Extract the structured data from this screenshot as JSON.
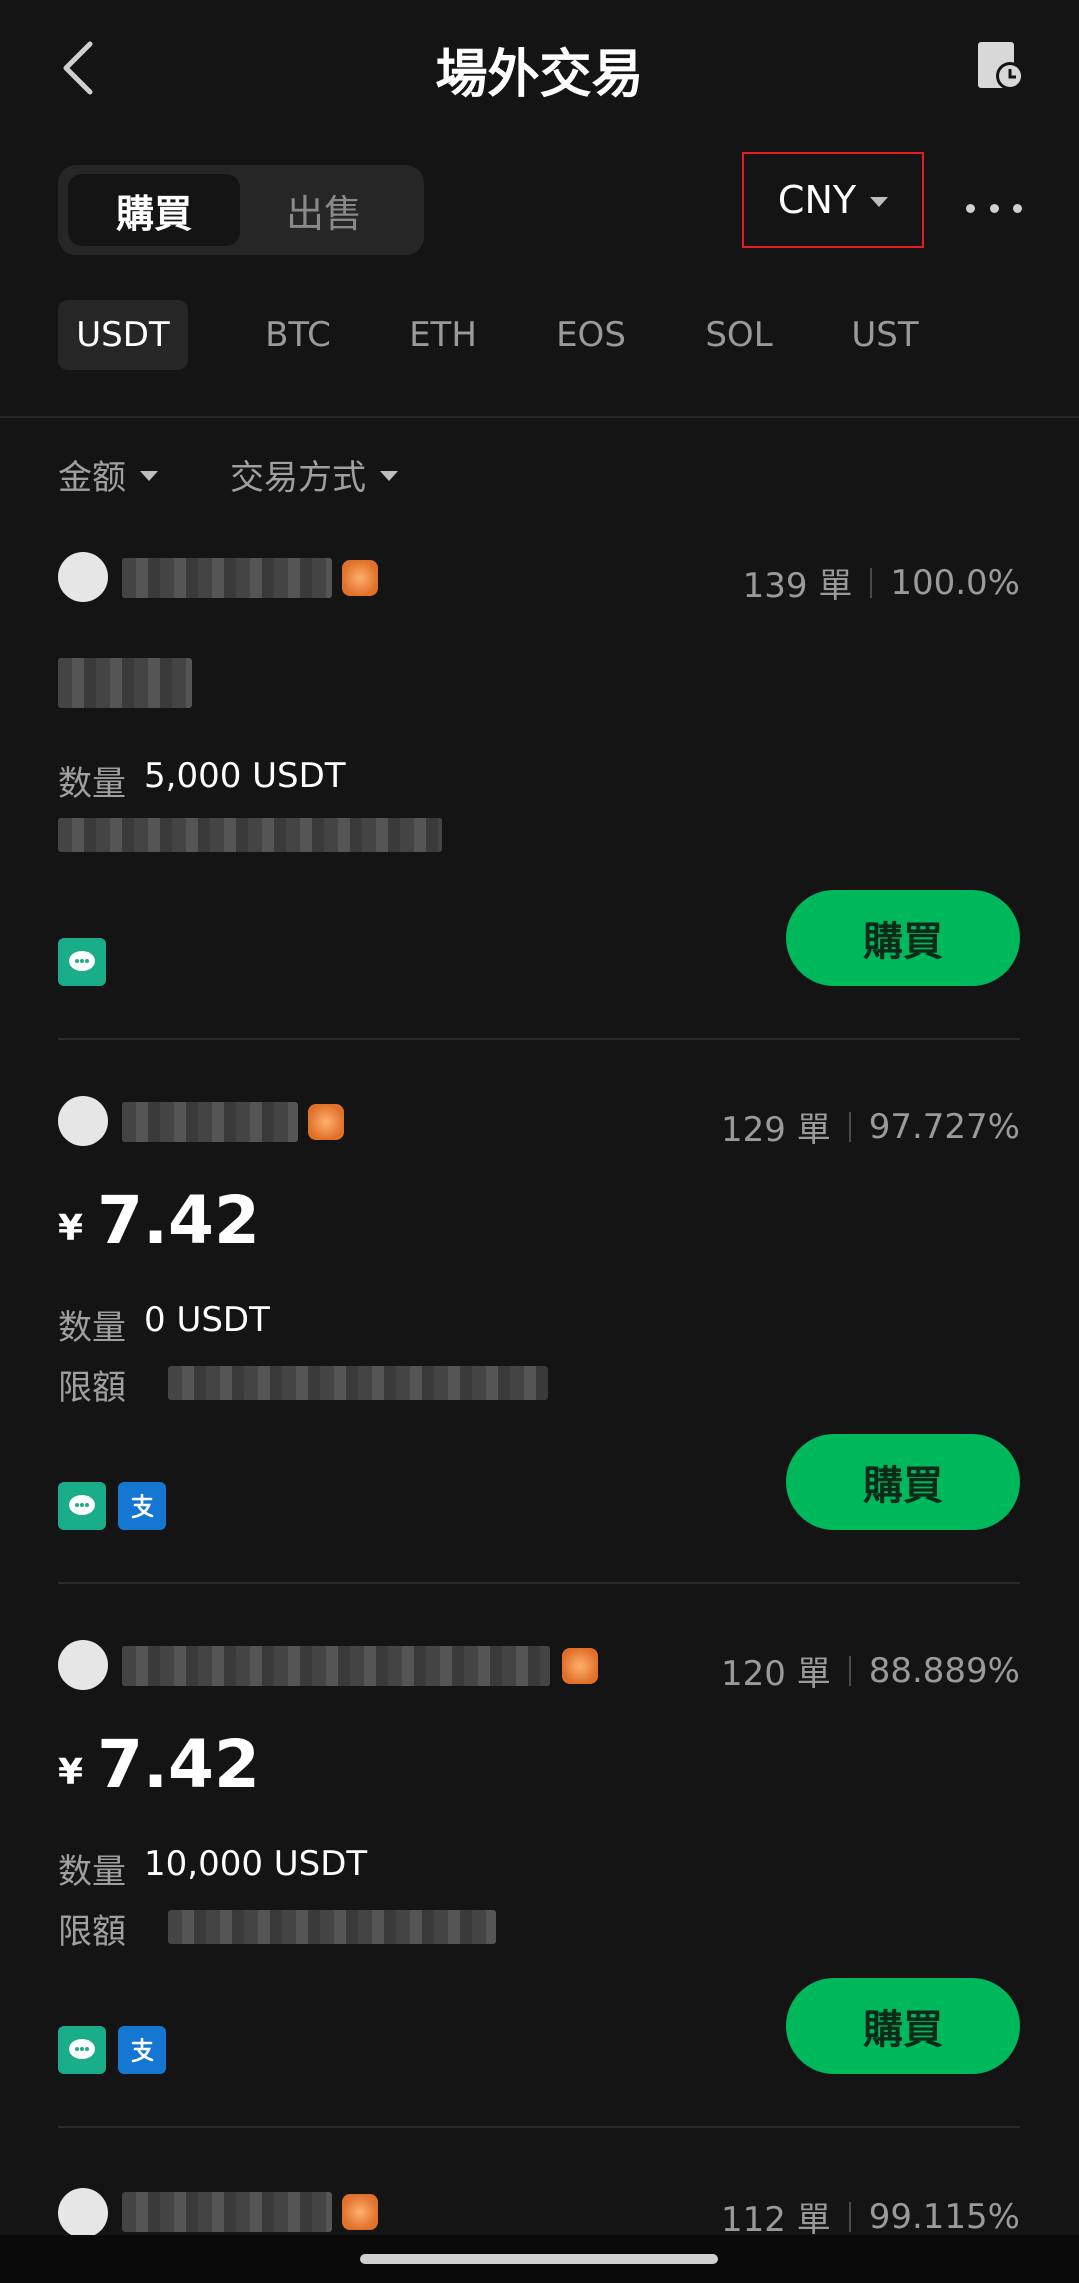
{
  "header": {
    "title": "場外交易"
  },
  "toggle": {
    "buy": "購買",
    "sell": "出售"
  },
  "currency": {
    "selected": "CNY"
  },
  "coins": [
    "USDT",
    "BTC",
    "ETH",
    "EOS",
    "SOL",
    "UST"
  ],
  "filters": {
    "amount": "金额",
    "payment": "交易方式"
  },
  "labels": {
    "quantity": "数量",
    "limit": "限額",
    "buy_button": "購買"
  },
  "ads": [
    {
      "orders": "139 單",
      "rate": "100.0%",
      "quantity": "5,000 USDT",
      "payments": [
        "wechat"
      ]
    },
    {
      "orders": "129 單",
      "rate": "97.727%",
      "price_symbol": "¥",
      "price": "7.42",
      "quantity": "0 USDT",
      "payments": [
        "wechat",
        "alipay"
      ]
    },
    {
      "orders": "120 單",
      "rate": "88.889%",
      "price_symbol": "¥",
      "price": "7.42",
      "quantity": "10,000 USDT",
      "payments": [
        "wechat",
        "alipay"
      ]
    },
    {
      "orders": "112 單",
      "rate": "99.115%"
    }
  ],
  "icons": {
    "back": "chevron-left-icon",
    "orders": "order-history-icon",
    "more": "more-dots-icon",
    "wechat": "wechat-pay-icon",
    "alipay": "alipay-icon"
  },
  "colors": {
    "accent": "#00b85c",
    "background": "#141414",
    "highlight_border": "#e02020"
  }
}
